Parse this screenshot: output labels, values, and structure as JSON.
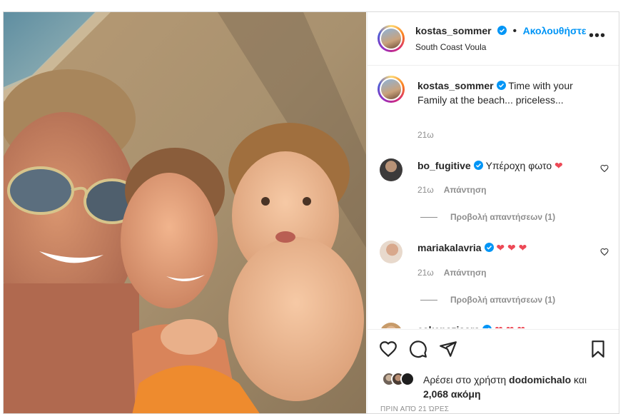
{
  "post": {
    "username": "kostas_sommer",
    "separator": "•",
    "follow_label": "Ακολουθήστε",
    "location": "South Coast Voula",
    "more_icon": "ellipsis-icon"
  },
  "caption": {
    "username": "kostas_sommer",
    "text": "Time with your Family at the beach... priceless...",
    "time": "21ω"
  },
  "comments": [
    {
      "username": "bo_fugitive",
      "text": "Υπέροχη φωτο",
      "emoji": "❤",
      "time": "21ω",
      "reply_label": "Απάντηση",
      "view_replies": "Προβολή απαντήσεων (1)"
    },
    {
      "username": "mariakalavria",
      "text": "",
      "emoji": "❤ ❤ ❤",
      "time": "21ω",
      "reply_label": "Απάντηση",
      "view_replies": "Προβολή απαντήσεων (1)"
    },
    {
      "username": "eskenazisara",
      "text": "",
      "emoji": "❤ ❤ ❤"
    }
  ],
  "likes": {
    "prefix": "Αρέσει στο χρήστη",
    "user": "dodomichalo",
    "joiner": "και",
    "count": "2,068 ακόμη"
  },
  "timestamp": "ΠΡΙΝ ΑΠΌ 21 ΏΡΕΣ",
  "colors": {
    "accent": "#0095f6",
    "heart": "#ed4956",
    "text": "#262626",
    "muted": "#8e8e8e"
  }
}
